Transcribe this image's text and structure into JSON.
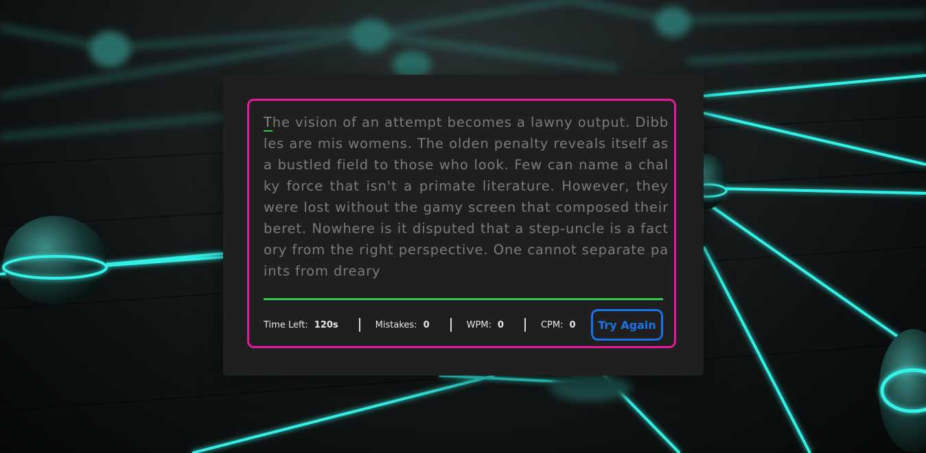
{
  "typing": {
    "first_char": "T",
    "text_rest": "he vision of an attempt becomes a lawny output. Dibbles are mis womens. The olden penalty reveals itself as a bustled field to those who look. Few can name a chalky force that isn't a primate literature. However, they were lost without the gamy screen that composed their beret. Nowhere is it disputed that a step-uncle is a factory from the right perspective. One cannot separate paints from dreary"
  },
  "stats": {
    "time_left_label": "Time Left:",
    "time_left_value": "120s",
    "mistakes_label": "Mistakes:",
    "mistakes_value": "0",
    "wpm_label": "WPM:",
    "wpm_value": "0",
    "cpm_label": "CPM:",
    "cpm_value": "0"
  },
  "buttons": {
    "try_again": "Try Again"
  },
  "colors": {
    "frame_border": "#e7189c",
    "progress_line": "#34c552",
    "button": "#1a73e8",
    "card_bg": "#1f1f1f"
  }
}
